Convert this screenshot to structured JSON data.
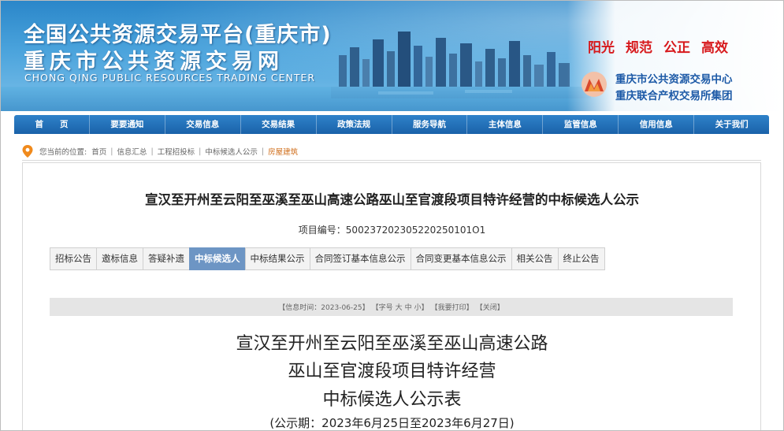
{
  "header": {
    "title_line_1": "全国公共资源交易平台(重庆市)",
    "title_line_2": "重庆市公共资源交易网",
    "title_en": "CHONG QING PUBLIC RESOURCES TRADING CENTER",
    "slogans": [
      "阳光",
      "规范",
      "公正",
      "高效"
    ],
    "org_line_1": "重庆市公共资源交易中心",
    "org_line_2": "重庆联合产权交易所集团",
    "colors": {
      "slogan": "#d7191c",
      "org_text": "#1d5aa7",
      "banner": "#2a86c9"
    }
  },
  "nav": {
    "items": [
      "首　　页",
      "要要通知",
      "交易信息",
      "交易结果",
      "政策法规",
      "服务导航",
      "主体信息",
      "监管信息",
      "信用信息",
      "关于我们"
    ]
  },
  "breadcrumb": {
    "prefix": "您当前的位置:",
    "items": [
      "首页",
      "信息汇总",
      "工程招投标",
      "中标候选人公示",
      "房屋建筑"
    ],
    "icon": "location-pin-icon"
  },
  "notice": {
    "title": "宣汉至开州至云阳至巫溪至巫山高速公路巫山至官渡段项目特许经营的中标候选人公示",
    "project_no_label": "项目编号：",
    "project_no": "500237202305220250101O1"
  },
  "tabs": {
    "items": [
      "招标公告",
      "邀标信息",
      "答疑补遗",
      "中标候选人",
      "中标结果公示",
      "合同签订基本信息公示",
      "合同变更基本信息公示",
      "相关公告",
      "终止公告"
    ],
    "active_index": 3,
    "active_color": "#6d95c4"
  },
  "info_bar": {
    "time": "【信息时间：2023-06-25】",
    "font_label": "【字号",
    "font_big": "大",
    "font_mid": "中",
    "font_small": "小】",
    "print": "【我要打印】",
    "close": "【关闭】"
  },
  "document": {
    "line_1": "宣汉至开州至云阳至巫溪至巫山高速公路",
    "line_2": "巫山至官渡段项目特许经营",
    "line_3": "中标候选人公示表",
    "period": "(公示期：2023年6月25日至2023年6月27日)"
  }
}
